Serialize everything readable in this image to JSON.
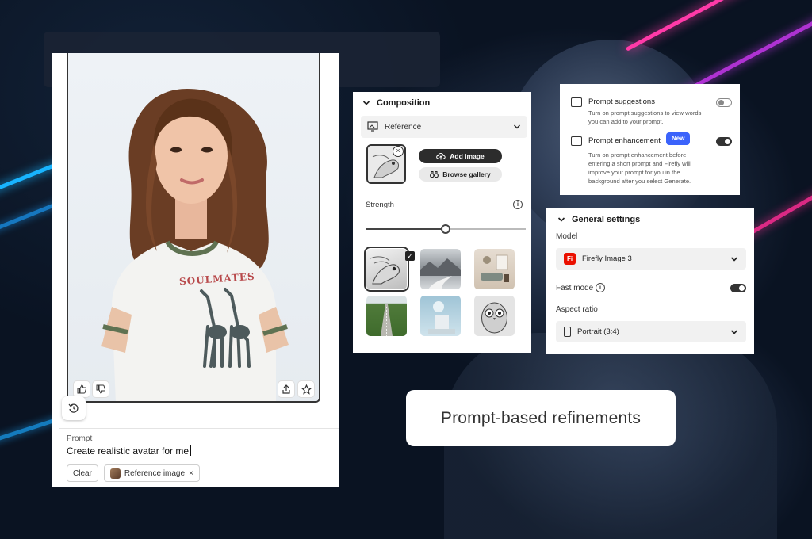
{
  "generation_card": {
    "prompt_label": "Prompt",
    "prompt_text": "Create realistic avatar for me",
    "clear_label": "Clear",
    "reference_chip_label": "Reference image",
    "reference_chip_close": "×"
  },
  "photo": {
    "shirt_text": "SOULMATES"
  },
  "composition": {
    "title": "Composition",
    "reference_label": "Reference",
    "add_image_label": "Add image",
    "browse_gallery_label": "Browse gallery",
    "strength_label": "Strength",
    "strength_value": 0.5,
    "style_thumbnails": [
      "bird-sketch",
      "mountain-lake",
      "living-room",
      "green-road",
      "sphere-sculpture",
      "owl-sketch"
    ]
  },
  "prompt_settings": {
    "suggestions_title": "Prompt suggestions",
    "suggestions_desc": "Turn on prompt suggestions to view words you can add to your prompt.",
    "suggestions_enabled": false,
    "enhancement_title": "Prompt enhancement",
    "enhancement_badge": "New",
    "enhancement_desc": "Turn on prompt enhancement before entering a short prompt and Firefly will improve your prompt for you in the background after you select Generate.",
    "enhancement_enabled": true
  },
  "general_settings": {
    "title": "General settings",
    "model_label": "Model",
    "model_logo": "Fi",
    "model_value": "Firefly Image 3",
    "fast_mode_label": "Fast mode",
    "fast_mode_enabled": true,
    "aspect_ratio_label": "Aspect ratio",
    "aspect_ratio_value": "Portrait (3:4)"
  },
  "caption": "Prompt-based refinements",
  "colors": {
    "accent_blue": "#3b63fb",
    "firefly_red": "#eb1000",
    "beam_pink": "#ff3aa8",
    "beam_blue": "#18b4ff"
  }
}
